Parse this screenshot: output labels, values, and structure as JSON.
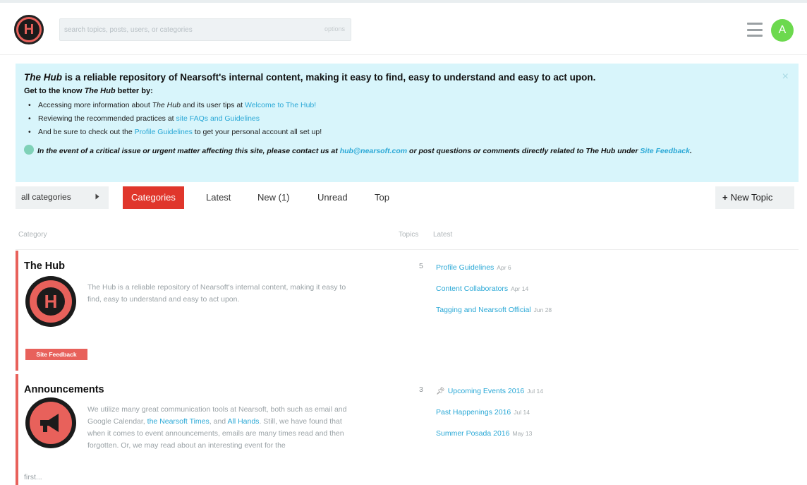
{
  "header": {
    "logo_letter": "H",
    "search_placeholder": "search topics, posts, users, or categories",
    "search_hint": "options",
    "avatar_letter": "A"
  },
  "banner": {
    "title_em": "The Hub",
    "title_rest": " is a reliable repository of Nearsoft's internal content, making it easy to find, easy to understand and easy to act upon.",
    "sub_pre": "Get to the know ",
    "sub_em": "The Hub",
    "sub_post": " better by:",
    "bullets": [
      {
        "pre": "Accessing more information about ",
        "em": "The Hub",
        "mid": " and its user tips at ",
        "link": "Welcome to The Hub!",
        "post": ""
      },
      {
        "pre": "Reviewing the recommended practices at ",
        "em": "",
        "mid": "",
        "link": "site FAQs and Guidelines",
        "post": ""
      },
      {
        "pre": "And be sure to check out the ",
        "em": "",
        "mid": "",
        "link": "Profile Guidelines",
        "post": " to get your personal account all set up!"
      }
    ],
    "note_pre": "In the event of a critical issue or urgent matter affecting this site, please contact us at ",
    "note_email": "hub@nearsoft.com",
    "note_mid": " or post questions or comments directly related to ",
    "note_em": "The Hub",
    "note_mid2": " under ",
    "note_link": "Site Feedback",
    "note_end": ".",
    "close": "×"
  },
  "nav": {
    "category_dropdown": "all categories",
    "tabs": [
      "Categories",
      "Latest",
      "New (1)",
      "Unread",
      "Top"
    ],
    "new_topic": "New Topic",
    "plus": "+"
  },
  "table": {
    "col_category": "Category",
    "col_topics": "Topics",
    "col_latest": "Latest"
  },
  "categories": [
    {
      "name": "The Hub",
      "logo_letter": "H",
      "description": "The Hub is a reliable repository of Nearsoft's internal content, making it easy to find, easy to understand and easy to act upon.",
      "topics": "5",
      "latest": [
        {
          "title": "Profile Guidelines",
          "date": "Apr 6"
        },
        {
          "title": "Content Collaborators",
          "date": "Apr 14"
        },
        {
          "title": "Tagging and Nearsoft Official",
          "date": "Jun 28"
        }
      ],
      "subcategory": "Site Feedback"
    },
    {
      "name": "Announcements",
      "description_pre": "We utilize many great communication tools at Nearsoft, both such as email and Google Calendar, ",
      "description_link1": "the Nearsoft Times",
      "description_mid": ", and ",
      "description_link2": "All Hands",
      "description_post": ". Still, we have found that when it comes to event announcements, emails are many times read and then forgotten. Or, we may read about an interesting event for the",
      "more": "first...",
      "topics": "3",
      "latest": [
        {
          "title": "Upcoming Events 2016",
          "date": "Jul 14",
          "pinned": true
        },
        {
          "title": "Past Happenings 2016",
          "date": "Jul 14"
        },
        {
          "title": "Summer Posada 2016",
          "date": "May 13"
        }
      ]
    }
  ],
  "colors": {
    "accent": "#e0362c",
    "category": "#e8615b",
    "link": "#2aa8d6",
    "banner": "#d8f5fb",
    "avatar": "#6cd94e"
  }
}
